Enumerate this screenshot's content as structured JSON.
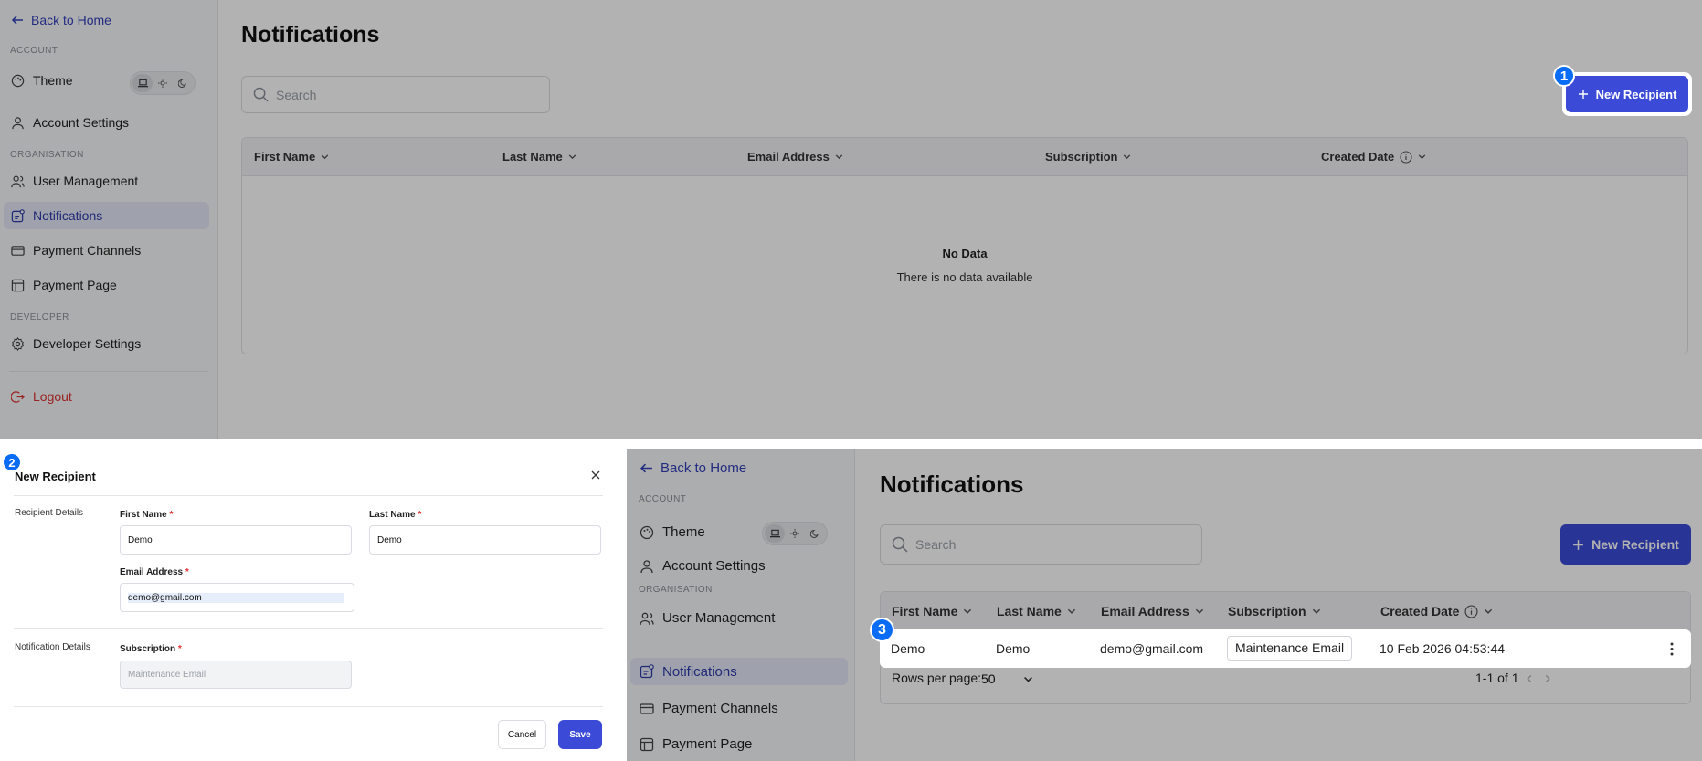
{
  "top": {
    "sidebar": {
      "back": "Back to Home",
      "sections": {
        "account": "ACCOUNT",
        "organisation": "ORGANISATION",
        "developer": "DEVELOPER"
      },
      "items": {
        "theme": "Theme",
        "account_settings": "Account Settings",
        "user_management": "User Management",
        "notifications": "Notifications",
        "payment_channels": "Payment Channels",
        "payment_page": "Payment Page",
        "developer_settings": "Developer Settings",
        "logout": "Logout"
      }
    },
    "title": "Notifications",
    "search_placeholder": "Search",
    "new_button": "New Recipient",
    "columns": [
      "First Name",
      "Last Name",
      "Email Address",
      "Subscription",
      "Created Date"
    ],
    "empty_title": "No Data",
    "empty_sub": "There is no data available"
  },
  "step_badges": [
    "1",
    "2",
    "3"
  ],
  "modal": {
    "title": "New Recipient",
    "section_recipient": "Recipient Details",
    "section_notification": "Notification Details",
    "first_name_label": "First Name",
    "last_name_label": "Last Name",
    "email_label": "Email Address",
    "subscription_label": "Subscription",
    "required_mark": "*",
    "first_name_value": "Demo",
    "last_name_value": "Demo",
    "email_value": "demo@gmail.com",
    "subscription_value": "Maintenance Email",
    "cancel": "Cancel",
    "save": "Save"
  },
  "bottom": {
    "sidebar": {
      "back": "Back to Home",
      "sections": {
        "account": "ACCOUNT",
        "organisation": "ORGANISATION"
      },
      "items": {
        "theme": "Theme",
        "account_settings": "Account Settings",
        "user_management": "User Management",
        "notifications": "Notifications",
        "payment_channels": "Payment Channels",
        "payment_page": "Payment Page"
      }
    },
    "title": "Notifications",
    "search_placeholder": "Search",
    "new_button": "New Recipient",
    "columns": [
      "First Name",
      "Last Name",
      "Email Address",
      "Subscription",
      "Created Date"
    ],
    "row": {
      "first_name": "Demo",
      "last_name": "Demo",
      "email": "demo@gmail.com",
      "subscription": "Maintenance Email",
      "created": "10 Feb 2026 04:53:44"
    },
    "rows_per_page_label": "Rows per page:",
    "rows_per_page_value": "50",
    "pagination": "1-1 of 1"
  },
  "colors": {
    "primary": "#3b4bd8",
    "step_badge": "#0a6cf5",
    "danger": "#d33333",
    "overlay": "rgba(0,0,0,0.30)"
  }
}
